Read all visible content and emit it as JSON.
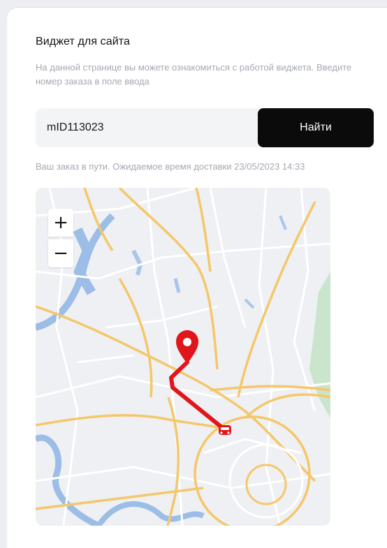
{
  "widget": {
    "title": "Виджет для сайта",
    "description": "На данной странице вы можете ознакомиться с работой виджета. Введите номер заказа в поле ввода",
    "order_input_value": "mID113023",
    "find_button_label": "Найти",
    "status_text": "Ваш заказ в пути. Ожидаемое время доставки 23/05/2023 14:33"
  },
  "map": {
    "zoom_in_label": "+",
    "zoom_out_label": "−",
    "icons": {
      "destination": "map-pin-icon",
      "courier": "car-icon"
    },
    "colors": {
      "route": "#e0161b",
      "roads_major": "#f5c76a",
      "water": "#8fb3e0",
      "park": "#c4e2c6",
      "background": "#eef0f3"
    }
  }
}
